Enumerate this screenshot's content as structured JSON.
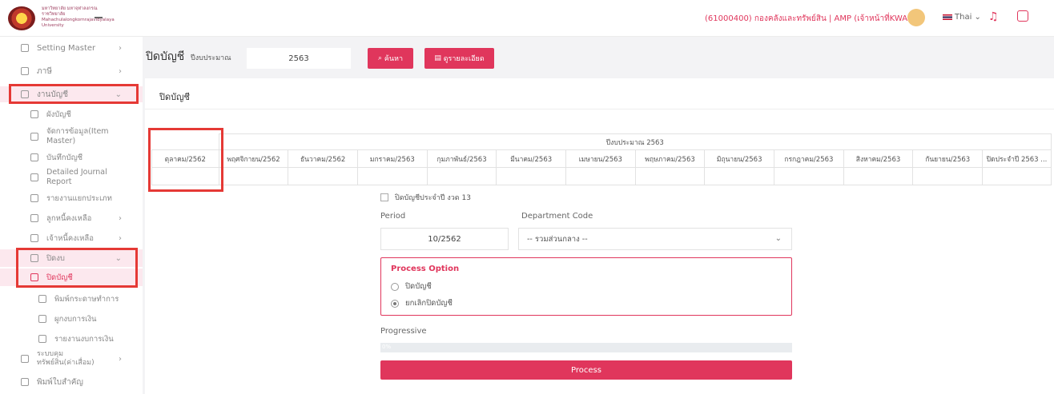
{
  "header": {
    "logo_text": "มหาวิทยาลัย มหาจุฬาลงกรณราชวิทยาลัย Mahachulalongkornrajavidyalaya University",
    "user_info": "(61000400) กองคลังและทรัพย์สิน | AMP (เจ้าหน้าที่KWANP)",
    "language": "Thai"
  },
  "sidebar": {
    "items": [
      {
        "label": "Setting Master"
      },
      {
        "label": "ภาษี"
      },
      {
        "label": "งานบัญชี"
      },
      {
        "label": "ผังบัญชี"
      },
      {
        "label": "จัดการข้อมูล(Item Master)"
      },
      {
        "label": "บันทึกบัญชี"
      },
      {
        "label": "Detailed Journal Report"
      },
      {
        "label": "รายงานแยกประเภท"
      },
      {
        "label": "ลูกหนี้คงเหลือ"
      },
      {
        "label": "เจ้าหนี้คงเหลือ"
      },
      {
        "label": "ปิดงบ"
      },
      {
        "label": "ปิดบัญชี"
      },
      {
        "label": "พิมพ์กระดาษทำการ"
      },
      {
        "label": "ผูกงบการเงิน"
      },
      {
        "label": "รายงานงบการเงิน"
      },
      {
        "label": "ระบบคุม ทรัพย์สิน(ค่าเสื่อม)"
      },
      {
        "label": "พิมพ์ใบสำคัญ"
      }
    ]
  },
  "toolbar": {
    "page_title": "ปิดบัญชี",
    "fiscal_year_label": "ปีงบประมาณ",
    "fiscal_year_value": "2563",
    "search_label": "ค้นหา",
    "detail_label": "ดูรายละเอียด"
  },
  "panel": {
    "title": "ปิดบัญชี",
    "table_group_header": "ปีงบประมาณ 2563",
    "months": [
      "ตุลาคม/2562",
      "พฤศจิกายน/2562",
      "ธันวาคม/2562",
      "มกราคม/2563",
      "กุมภาพันธ์/2563",
      "มีนาคม/2563",
      "เมษายน/2563",
      "พฤษภาคม/2563",
      "มิถุนายน/2563",
      "กรกฎาคม/2563",
      "สิงหาคม/2563",
      "กันยายน/2563",
      "ปิดประจำปี 2563 ..."
    ],
    "close_year_checkbox": "ปิดบัญชีประจำปี งวด 13",
    "period_label": "Period",
    "period_value": "10/2562",
    "department_label": "Department Code",
    "department_value": "-- รวมส่วนกลาง --",
    "process_option_title": "Process Option",
    "option_close": "ปิดบัญชี",
    "option_cancel": "ยกเลิกปิดบัญชี",
    "progressive_label": "Progressive",
    "progress_text": "0%",
    "progress_value": 0,
    "process_button": "Process"
  }
}
